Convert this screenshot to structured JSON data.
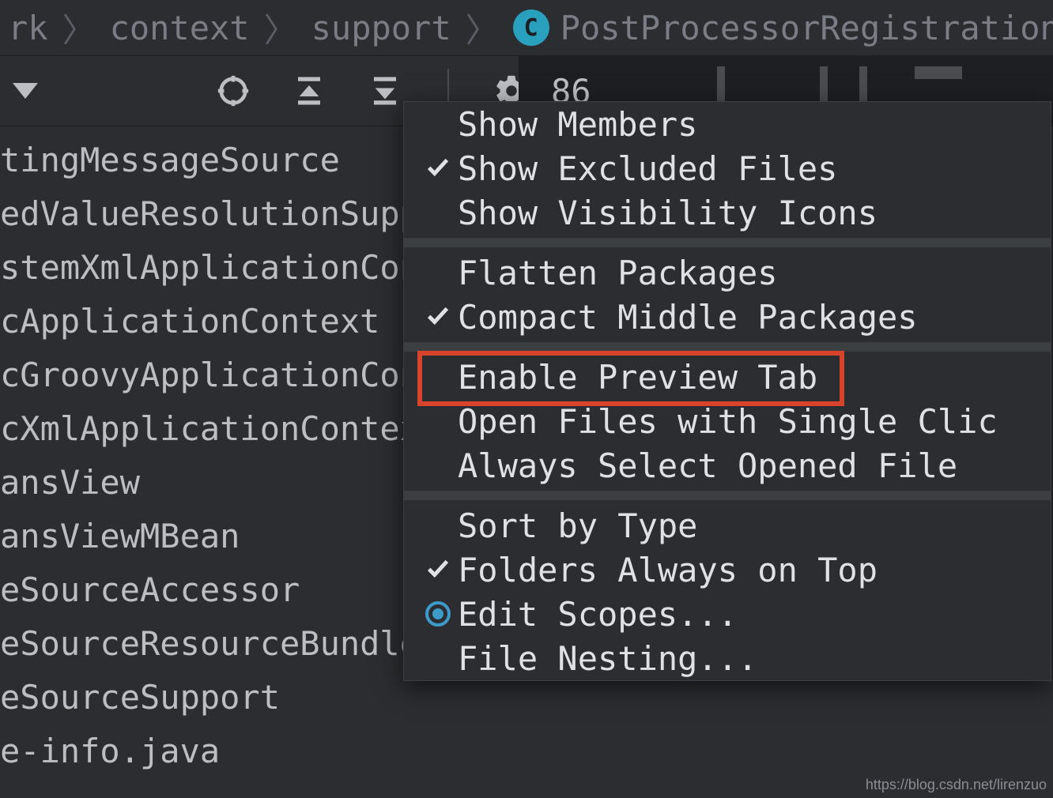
{
  "breadcrumb": {
    "items": [
      "rk",
      "context",
      "support",
      "PostProcessorRegistrationDele"
    ],
    "class_icon_letter": "C"
  },
  "editor": {
    "line_number": "86"
  },
  "tree": {
    "items": [
      "tingMessageSource",
      "edValueResolutionSupp",
      "stemXmlApplicationCon",
      "cApplicationContext",
      "cGroovyApplicationCon",
      "cXmlApplicationContex",
      "ansView",
      "ansViewMBean",
      "eSourceAccessor",
      "eSourceResourceBundle",
      "eSourceSupport",
      "e-info.java"
    ]
  },
  "menu": {
    "groups": [
      [
        {
          "label": "Show Members",
          "checked": false
        },
        {
          "label": "Show Excluded Files",
          "checked": true
        },
        {
          "label": "Show Visibility Icons",
          "checked": false
        }
      ],
      [
        {
          "label": "Flatten Packages",
          "checked": false
        },
        {
          "label": "Compact Middle Packages",
          "checked": true
        }
      ],
      [
        {
          "label": "Enable Preview Tab",
          "checked": false,
          "highlighted": true
        },
        {
          "label": "Open Files with Single Clic",
          "checked": false
        },
        {
          "label": "Always Select Opened File",
          "checked": false
        }
      ],
      [
        {
          "label": "Sort by Type",
          "checked": false
        },
        {
          "label": "Folders Always on Top",
          "checked": true
        },
        {
          "label": "Edit Scopes...",
          "radio": true
        },
        {
          "label": "File Nesting...",
          "checked": false
        }
      ]
    ]
  },
  "watermark": "https://blog.csdn.net/lirenzuo"
}
